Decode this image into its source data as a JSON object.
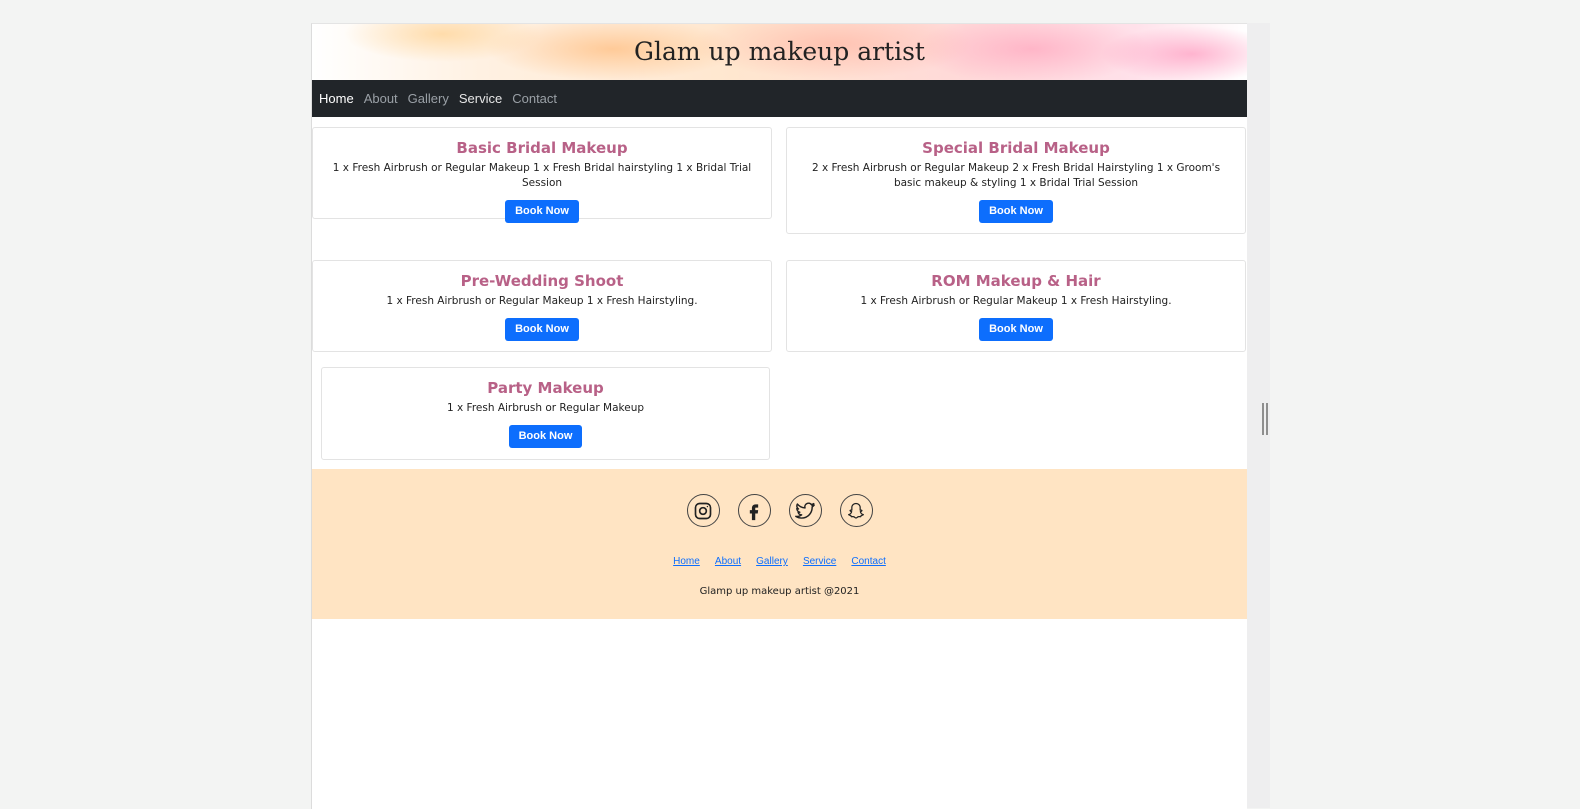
{
  "site": {
    "title": "Glam up makeup artist"
  },
  "nav": {
    "items": [
      {
        "label": "Home"
      },
      {
        "label": "About"
      },
      {
        "label": "Gallery"
      },
      {
        "label": "Service"
      },
      {
        "label": "Contact"
      }
    ]
  },
  "services": [
    {
      "title": "Basic Bridal Makeup",
      "description": "1 x Fresh Airbrush or Regular Makeup 1 x Fresh Bridal hairstyling 1 x Bridal Trial Session",
      "button": "Book Now"
    },
    {
      "title": "Special Bridal Makeup",
      "description": "2 x Fresh Airbrush or Regular Makeup 2 x Fresh Bridal Hairstyling 1 x Groom's basic makeup & styling 1 x Bridal Trial Session",
      "button": "Book Now"
    },
    {
      "title": "Pre-Wedding Shoot",
      "description": "1 x Fresh Airbrush or Regular Makeup 1 x Fresh Hairstyling.",
      "button": "Book Now"
    },
    {
      "title": "ROM Makeup & Hair",
      "description": "1 x Fresh Airbrush or Regular Makeup 1 x Fresh Hairstyling.",
      "button": "Book Now"
    },
    {
      "title": "Party Makeup",
      "description": "1 x Fresh Airbrush or Regular Makeup",
      "button": "Book Now"
    }
  ],
  "footer": {
    "social": [
      {
        "icon": "instagram-icon"
      },
      {
        "icon": "facebook-icon"
      },
      {
        "icon": "twitter-icon"
      },
      {
        "icon": "snapchat-icon"
      }
    ],
    "links": [
      {
        "label": "Home"
      },
      {
        "label": "About"
      },
      {
        "label": "Gallery"
      },
      {
        "label": "Service"
      },
      {
        "label": "Contact"
      }
    ],
    "copyright": "Glamp up makeup artist @2021"
  },
  "colors": {
    "accent": "#0d6efd",
    "title_pink": "#b86187",
    "navbar": "#212529",
    "footer_bg": "#ffe4c3"
  }
}
